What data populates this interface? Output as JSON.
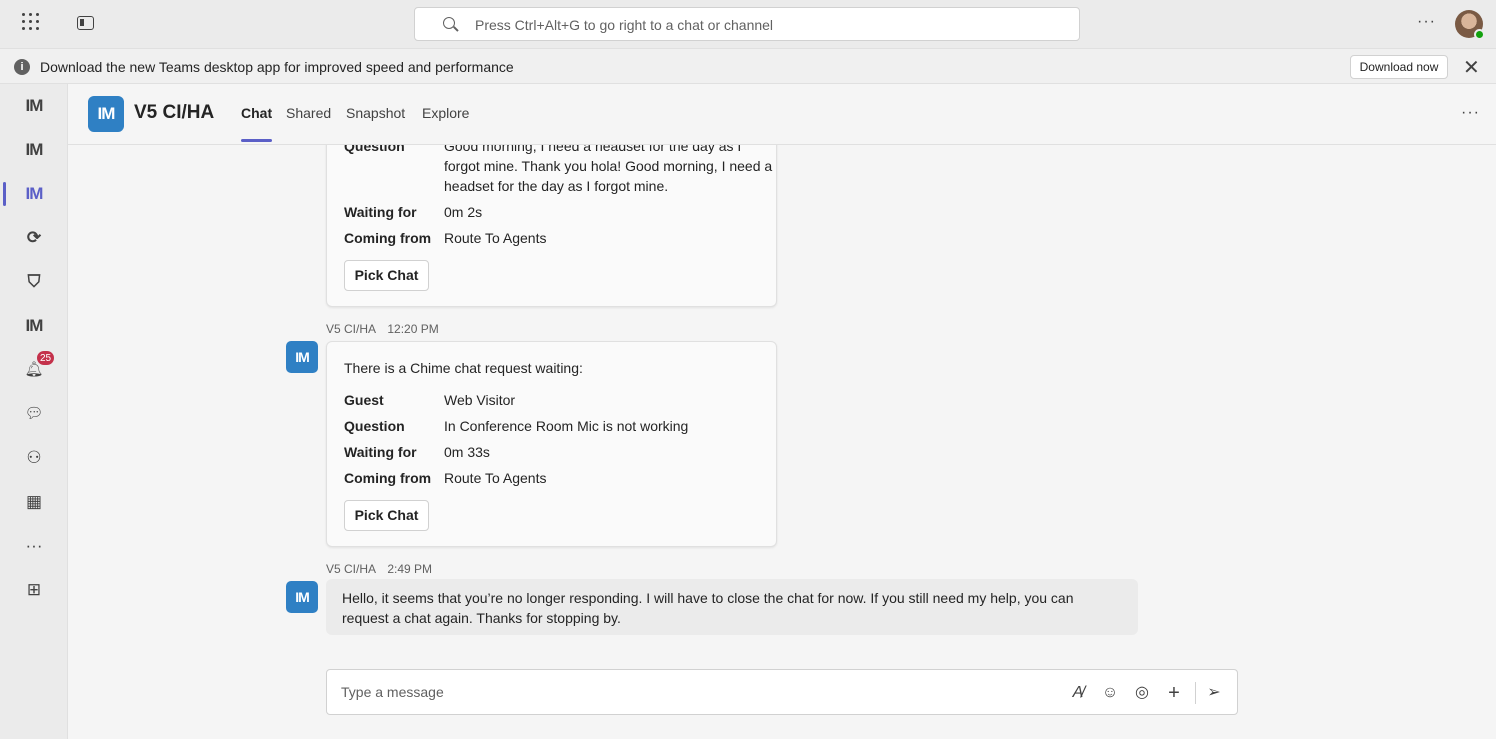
{
  "topbar": {
    "search_placeholder": "Press Ctrl+Alt+G to go right to a chat or channel",
    "more": "···"
  },
  "banner": {
    "text": "Download the new Teams desktop app for improved speed and performance",
    "info_glyph": "i",
    "download_label": "Download now",
    "close_glyph": "✕"
  },
  "rail": {
    "items": [
      {
        "icon": "im-app-icon",
        "glyph": "IM"
      },
      {
        "icon": "im-app-icon",
        "glyph": "IM"
      },
      {
        "icon": "im-app-icon",
        "glyph": "IM",
        "active": true
      },
      {
        "icon": "copilot-icon",
        "glyph": "⟳"
      },
      {
        "icon": "shield-app-icon",
        "glyph": "⛉"
      },
      {
        "icon": "im-app-icon",
        "glyph": "IM"
      },
      {
        "icon": "bell-icon",
        "glyph": "🔔︎",
        "badge": "25"
      },
      {
        "icon": "chat-icon",
        "glyph": "💬︎"
      },
      {
        "icon": "teams-icon",
        "glyph": "⚇"
      },
      {
        "icon": "calendar-icon",
        "glyph": "▦"
      },
      {
        "icon": "more-apps-icon",
        "glyph": "···"
      },
      {
        "icon": "add-app-icon",
        "glyph": "⊞"
      }
    ],
    "badge": "25"
  },
  "header": {
    "logo_text": "IM",
    "title": "V5 CI/HA",
    "tabs": [
      {
        "label": "Chat",
        "active": true
      },
      {
        "label": "Shared"
      },
      {
        "label": "Snapshot"
      },
      {
        "label": "Explore"
      }
    ],
    "more": "···"
  },
  "messages": {
    "first_card": {
      "question_label": "Question",
      "question_text": "Good morning, I need a headset for the day as I forgot mine. Thank you hola! Good morning, I need a headset for the day as I forgot mine.",
      "waiting_label": "Waiting for",
      "waiting_value": "0m 2s",
      "from_label": "Coming from",
      "from_value": "Route To Agents",
      "button": "Pick Chat"
    },
    "second": {
      "sender": "V5 CI/HA",
      "time": "12:20 PM",
      "avatar": "IM",
      "intro": "There is a Chime chat request waiting:",
      "guest_label": "Guest",
      "guest_value": "Web Visitor",
      "question_label": "Question",
      "question_text": "In Conference Room Mic is not working",
      "waiting_label": "Waiting for",
      "waiting_value": "0m 33s",
      "from_label": "Coming from",
      "from_value": "Route To Agents",
      "button": "Pick Chat"
    },
    "third": {
      "sender": "V5 CI/HA",
      "time": "2:49 PM",
      "avatar": "IM",
      "text": "Hello, it seems that you’re no longer responding. I will have to close the chat for now. If you still need my help, you can request a chat again. Thanks for stopping by."
    }
  },
  "composer": {
    "placeholder": "Type a message"
  }
}
